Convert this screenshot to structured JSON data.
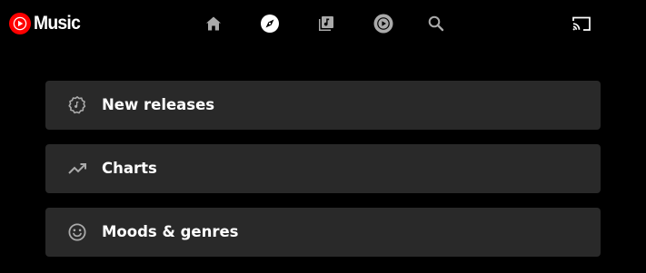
{
  "app": {
    "name": "Music",
    "brand_color": "#ff0000"
  },
  "nav": {
    "items": [
      {
        "icon": "home-icon",
        "color": "#aaaaaa"
      },
      {
        "icon": "compass-icon",
        "color": "#ffffff",
        "active": true
      },
      {
        "icon": "library-icon",
        "color": "#aaaaaa"
      },
      {
        "icon": "play-circle-icon",
        "color": "#aaaaaa"
      },
      {
        "icon": "search-icon",
        "color": "#aaaaaa"
      }
    ],
    "cast_icon": "cast-icon"
  },
  "explore": {
    "items": [
      {
        "label": "New releases",
        "icon": "new-releases-icon"
      },
      {
        "label": "Charts",
        "icon": "trending-up-icon"
      },
      {
        "label": "Moods & genres",
        "icon": "smiley-icon"
      }
    ]
  },
  "colors": {
    "background": "#000000",
    "card": "#292929",
    "icon_inactive": "#aaaaaa",
    "text": "#ffffff"
  }
}
